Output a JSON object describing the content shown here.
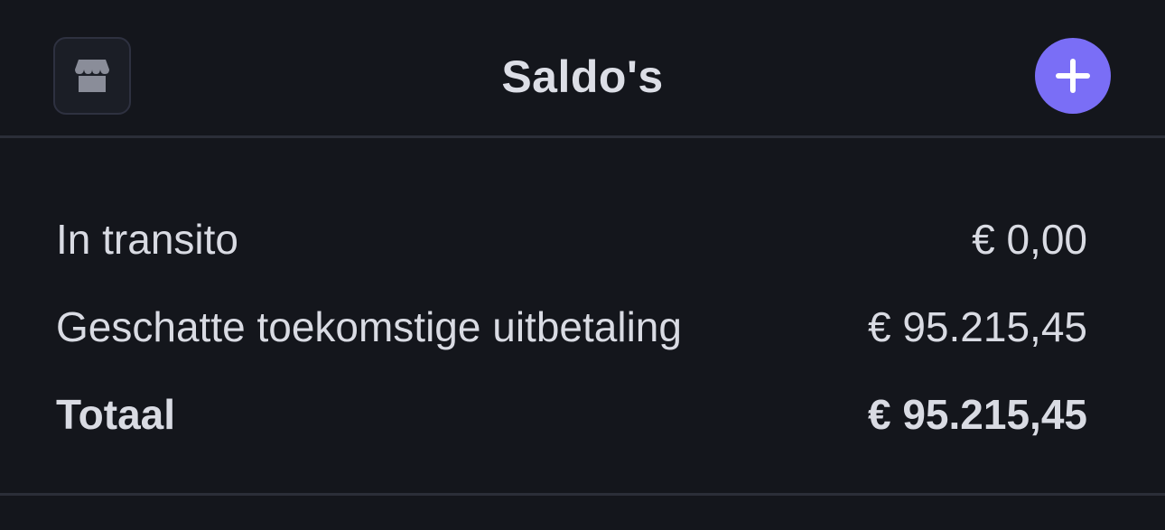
{
  "header": {
    "title": "Saldo's",
    "store_icon": "store-icon",
    "add_icon": "plus-icon"
  },
  "balances": {
    "rows": [
      {
        "label": "In transito",
        "amount": "€ 0,00"
      },
      {
        "label": "Geschatte toekomstige uitbetaling",
        "amount": "€ 95.215,45"
      },
      {
        "label": "Totaal",
        "amount": "€ 95.215,45"
      }
    ]
  },
  "colors": {
    "background": "#14161c",
    "accent": "#7a6ef6",
    "text": "#dcdee6",
    "divider": "#2b2e38"
  }
}
